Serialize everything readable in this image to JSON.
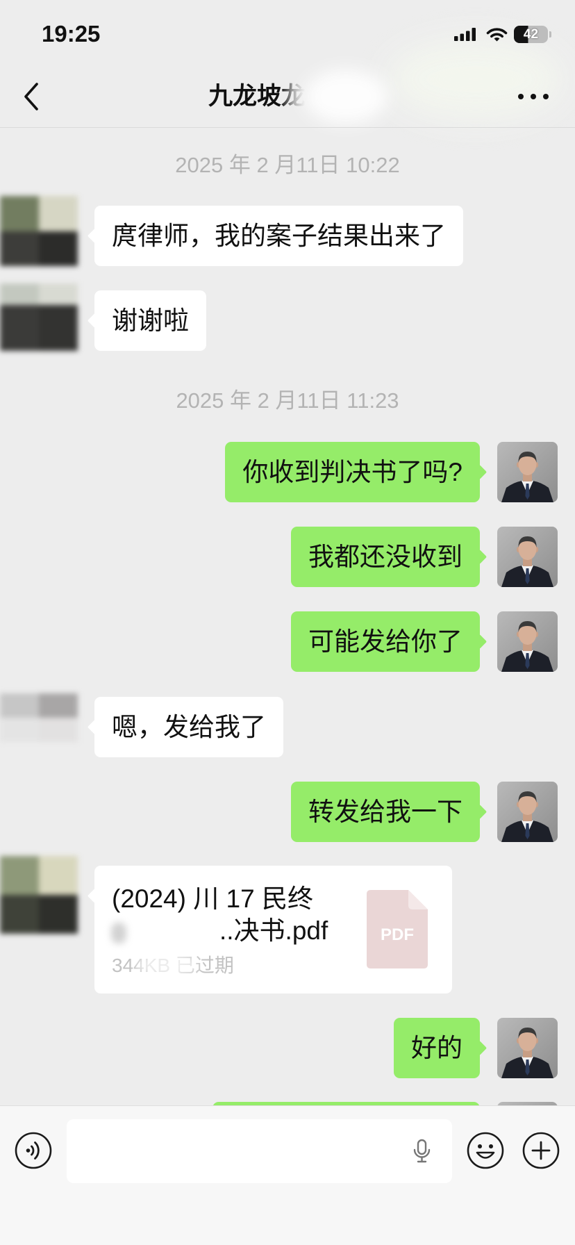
{
  "status_bar": {
    "time": "19:25",
    "battery": "42",
    "icons": [
      "cellular-signal-icon",
      "wifi-icon",
      "battery-icon"
    ]
  },
  "header": {
    "title": "九龙坡龙",
    "back_icon": "chevron-left-icon",
    "more_icon": "more-dots-icon"
  },
  "colors": {
    "background": "#ededed",
    "bubble_self": "#95ec69",
    "bubble_other": "#ffffff",
    "timestamp": "#b3b3b3",
    "pdf_icon": "#ead6d6"
  },
  "timestamps": [
    "2025 年 2 月11日 10:22",
    "2025 年 2 月11日 11:23"
  ],
  "messages": [
    {
      "text": "庹律师，我的案子结果出来了"
    },
    {
      "text": "谢谢啦"
    },
    {
      "text": "你收到判决书了吗?"
    },
    {
      "text": "我都还没收到"
    },
    {
      "text": "可能发给你了"
    },
    {
      "text": "嗯，发给我了"
    },
    {
      "text": "转发给我一下"
    },
    {
      "text": "好的"
    }
  ],
  "file_message": {
    "name_line1": "(2024) 川 17 民终",
    "name_line2": "..决书.pdf",
    "meta": "344KB 已过期",
    "icon_label": "PDF"
  },
  "input_bar": {
    "voice_icon": "voice-input-icon",
    "mic_icon": "microphone-icon",
    "emoji_icon": "emoji-icon",
    "plus_icon": "plus-icon"
  }
}
